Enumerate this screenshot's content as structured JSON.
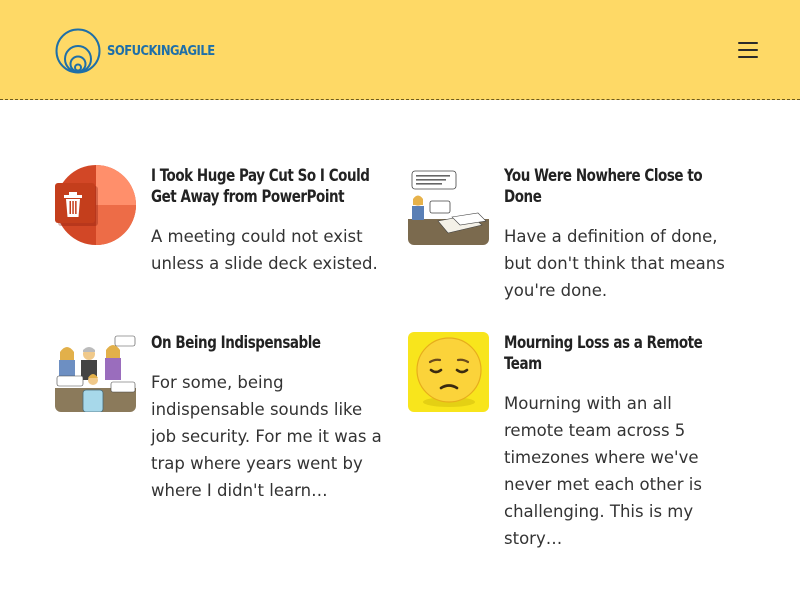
{
  "site": {
    "logo_text": "SOFUCKINGAGILE",
    "menu_icon": "hamburger-menu-icon"
  },
  "posts": [
    {
      "title": "I Took Huge Pay Cut So I Could Get Away from PowerPoint",
      "excerpt": "A meeting could not exist unless a slide deck existed.",
      "thumb_icon": "powerpoint-trash-icon"
    },
    {
      "title": "You Were Nowhere Close to Done",
      "excerpt": "Have a definition of done, but don't think that means you're done.",
      "thumb_icon": "meeting-comic-image"
    },
    {
      "title": "On Being Indispensable",
      "excerpt": "For some, being indispensable sounds like job security. For me it was a trap where years went by where I didn't learn…",
      "thumb_icon": "team-comic-image"
    },
    {
      "title": "Mourning Loss as a Remote Team",
      "excerpt": "Mourning with an all remote team across 5 timezones where we've never met each other is challenging. This is my story…",
      "thumb_icon": "sad-emoji-image"
    }
  ]
}
